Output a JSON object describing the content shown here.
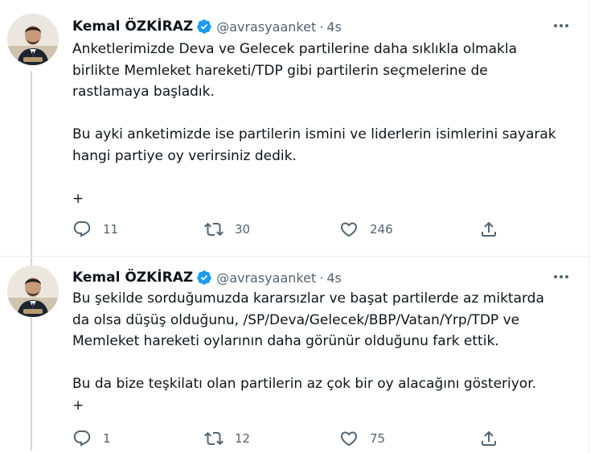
{
  "colors": {
    "text": "#0f1419",
    "secondary": "#536471",
    "verified": "#1d9bf0",
    "divider": "#ebeef0",
    "thread": "#cfd9de"
  },
  "tweets": [
    {
      "display_name": "Kemal ÖZKİRAZ",
      "handle": "@avrasyaanket",
      "separator": "·",
      "time": "4s",
      "text": "Anketlerimizde Deva ve Gelecek partilerine daha sıklıkla olmakla\nbirlikte Memleket hareketi/TDP gibi partilerin seçmelerine de\nrastlamaya başladık.\n\nBu ayki anketimizde ise partilerin ismini ve liderlerin isimlerini sayarak\nhangi partiye oy verirsiniz dedik.\n\n+",
      "replies": "11",
      "retweets": "30",
      "likes": "246"
    },
    {
      "display_name": "Kemal ÖZKİRAZ",
      "handle": "@avrasyaanket",
      "separator": "·",
      "time": "4s",
      "text": "Bu şekilde sorduğumuzda kararsızlar ve başat partilerde az miktarda\nda olsa düşüş olduğunu, /SP/Deva/Gelecek/BBP/Vatan/Yrp/TDP ve\nMemleket hareketi oylarının daha görünür olduğunu fark ettik.\n\nBu da bize teşkilatı olan partilerin az çok bir oy alacağını gösteriyor.\n+",
      "replies": "1",
      "retweets": "12",
      "likes": "75"
    }
  ]
}
